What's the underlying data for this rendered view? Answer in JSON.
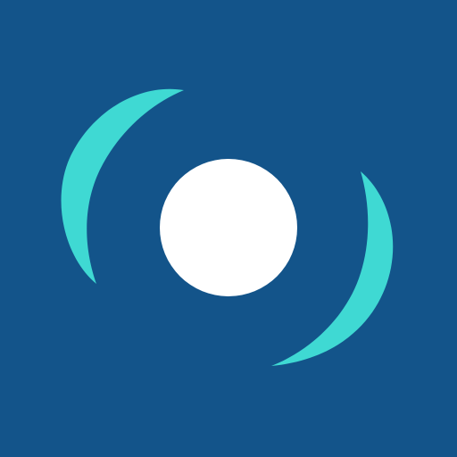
{
  "icon": {
    "name": "radar-signal-app-icon",
    "colors": {
      "background": "#13548A",
      "arc": "#3FD9D3",
      "center": "#FFFFFF"
    },
    "elements": [
      "center-dot",
      "left-arc",
      "right-arc"
    ]
  }
}
